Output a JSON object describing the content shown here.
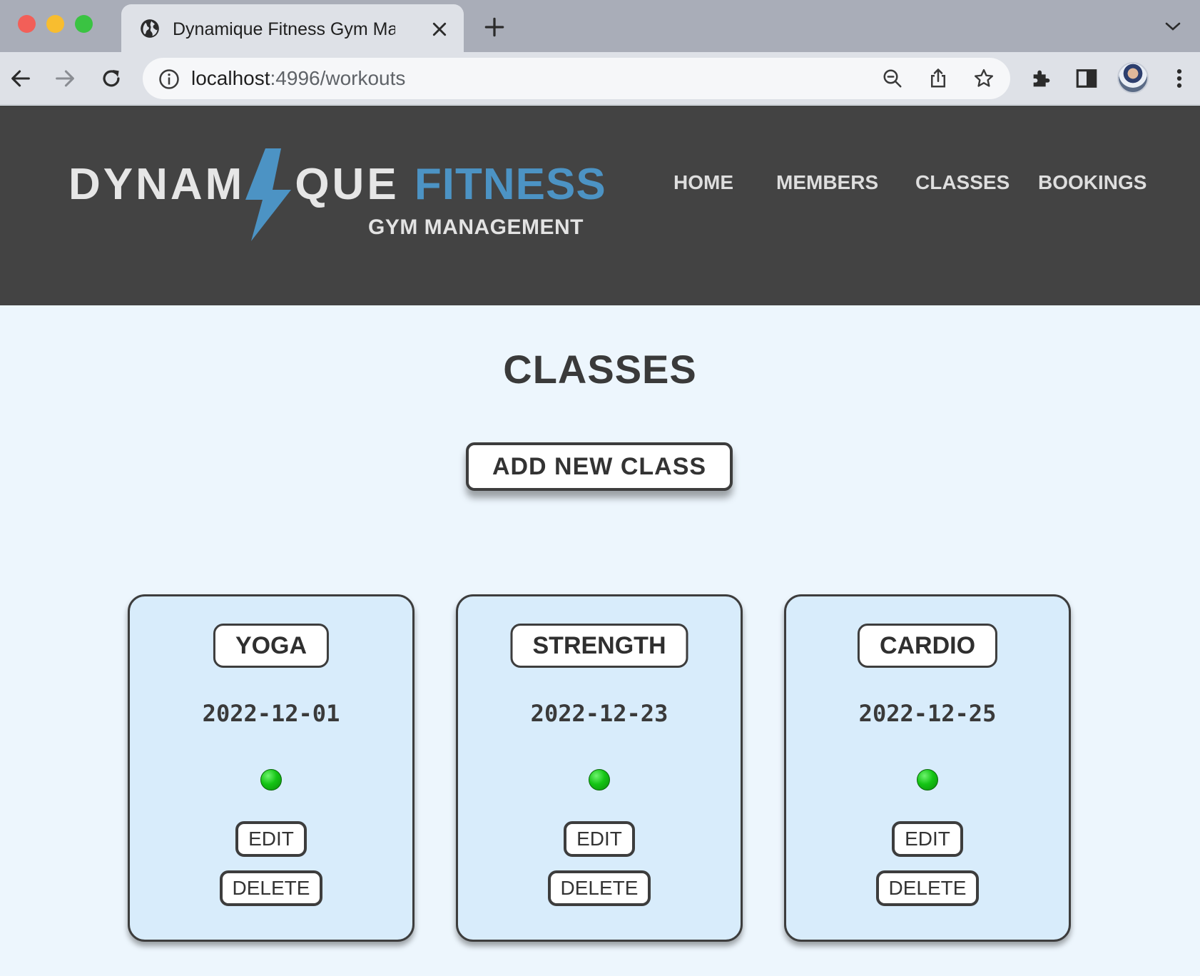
{
  "browser": {
    "tab_title": "Dynamique Fitness Gym Management",
    "url_host": "localhost",
    "url_rest": ":4996/workouts"
  },
  "site": {
    "logo_part1": "DYNAM",
    "logo_part2": "QUE",
    "logo_accent": "FITNESS",
    "logo_subtitle": "GYM MANAGEMENT",
    "nav": [
      "HOME",
      "MEMBERS",
      "CLASSES",
      "BOOKINGS"
    ]
  },
  "main": {
    "title": "CLASSES",
    "add_button": "ADD NEW CLASS"
  },
  "classes": [
    {
      "name": "YOGA",
      "date": "2022-12-01",
      "status": "green",
      "edit": "EDIT",
      "delete": "DELETE"
    },
    {
      "name": "STRENGTH",
      "date": "2022-12-23",
      "status": "green",
      "edit": "EDIT",
      "delete": "DELETE"
    },
    {
      "name": "CARDIO",
      "date": "2022-12-25",
      "status": "green",
      "edit": "EDIT",
      "delete": "DELETE"
    }
  ],
  "colors": {
    "header_bg": "#434343",
    "accent": "#4c93c4",
    "page_bg": "#edf6fd",
    "card_bg": "#d8ecfb",
    "status_green": "#14c414"
  }
}
